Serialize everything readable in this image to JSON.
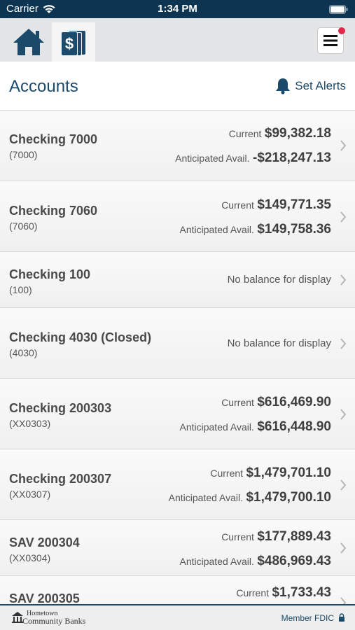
{
  "status_bar": {
    "carrier": "Carrier",
    "time": "1:34 PM"
  },
  "nav": {
    "home_icon": "home-icon",
    "accounts_icon": "dollar-document-icon",
    "menu_icon": "hamburger-menu-icon"
  },
  "header": {
    "title": "Accounts",
    "alerts_label": "Set Alerts"
  },
  "accounts": [
    {
      "name": "Checking 7000",
      "number": "(7000)",
      "current_label": "Current",
      "current": "$99,382.18",
      "avail_label": "Anticipated Avail.",
      "avail": "-$218,247.13"
    },
    {
      "name": "Checking 7060",
      "number": "(7060)",
      "current_label": "Current",
      "current": "$149,771.35",
      "avail_label": "Anticipated Avail.",
      "avail": "$149,758.36"
    },
    {
      "name": "Checking 100",
      "number": "(100)",
      "no_balance": "No balance for display"
    },
    {
      "name": "Checking 4030 (Closed)",
      "number": "(4030)",
      "no_balance": "No balance for display"
    },
    {
      "name": "Checking 200303",
      "number": "(XX0303)",
      "current_label": "Current",
      "current": "$616,469.90",
      "avail_label": "Anticipated Avail.",
      "avail": "$616,448.90"
    },
    {
      "name": "Checking 200307",
      "number": "(XX0307)",
      "current_label": "Current",
      "current": "$1,479,701.10",
      "avail_label": "Anticipated Avail.",
      "avail": "$1,479,700.10"
    },
    {
      "name": "SAV 200304",
      "number": "(XX0304)",
      "current_label": "Current",
      "current": "$177,889.43",
      "avail_label": "Anticipated Avail.",
      "avail": "$486,969.43"
    },
    {
      "name": "SAV 200305",
      "number": "",
      "current_label": "Current",
      "current": "$1,733.43"
    }
  ],
  "footer": {
    "bank_line1": "Hometown",
    "bank_line2": "Community Banks",
    "fdic": "Member FDIC"
  },
  "colors": {
    "brand": "#1b4a6b",
    "status_bar": "#0d3551",
    "badge": "#e0284a"
  }
}
